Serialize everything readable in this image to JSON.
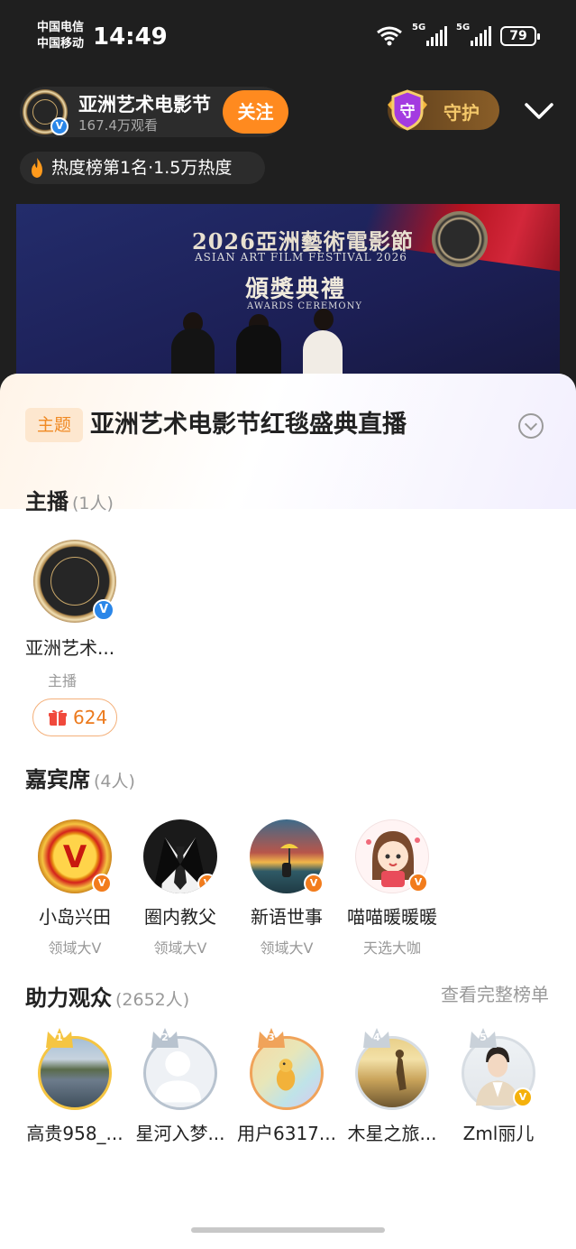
{
  "status_bar": {
    "carrier_1": "中国电信",
    "carrier_2": "中国移动",
    "time": "14:49",
    "net_1": "5G",
    "net_2": "5G",
    "battery": "79"
  },
  "live_header": {
    "anchor_name": "亚洲艺术电影节",
    "viewers": "167.4万观看",
    "follow_label": "关注",
    "guard_label": "守护",
    "guard_icon_char": "守",
    "heat_text": "热度榜第1名·1.5万热度"
  },
  "video": {
    "line_1": "2026亞洲藝術電影節",
    "line_2": "ASIAN ART FILM FESTIVAL 2026",
    "line_3": "頒獎典禮",
    "line_4": "AWARDS CEREMONY"
  },
  "topic": {
    "tag": "主题",
    "title": "亚洲艺术电影节红毯盛典直播"
  },
  "host_section": {
    "title": "主播",
    "count": "(1人)",
    "host": {
      "name": "亚洲艺术...",
      "role": "主播",
      "gift_count": "624"
    }
  },
  "guests_section": {
    "title": "嘉宾席",
    "count": "(4人)",
    "guests": [
      {
        "name": "小岛兴田",
        "role": "领域大V",
        "avatar": "gold-v-medal"
      },
      {
        "name": "圈内教父",
        "role": "领域大V",
        "avatar": "suit-tie"
      },
      {
        "name": "新语世事",
        "role": "领域大V",
        "avatar": "landscape-painting"
      },
      {
        "name": "喵喵暖暖暖",
        "role": "天选大咖",
        "avatar": "cartoon-girl"
      }
    ]
  },
  "audience_section": {
    "title": "助力观众",
    "count": "(2652人)",
    "see_all": "查看完整榜单",
    "viewers": [
      {
        "rank": "1",
        "name": "高贵958_...",
        "avatar": "lake-photo"
      },
      {
        "rank": "2",
        "name": "星河入梦...",
        "avatar": "default-avatar"
      },
      {
        "rank": "3",
        "name": "用户6317...",
        "avatar": "cartoon-chick"
      },
      {
        "rank": "4",
        "name": "木星之旅...",
        "avatar": "sunset-beach"
      },
      {
        "rank": "5",
        "name": "Zml丽儿",
        "avatar": "man-portrait"
      }
    ]
  },
  "colors": {
    "accent_orange": "#ff8a1f",
    "gold_crown": "#f5c542",
    "silver_crown": "#b8c3cf",
    "bronze_crown": "#f0a35a",
    "verified_blue": "#2a86e8"
  }
}
